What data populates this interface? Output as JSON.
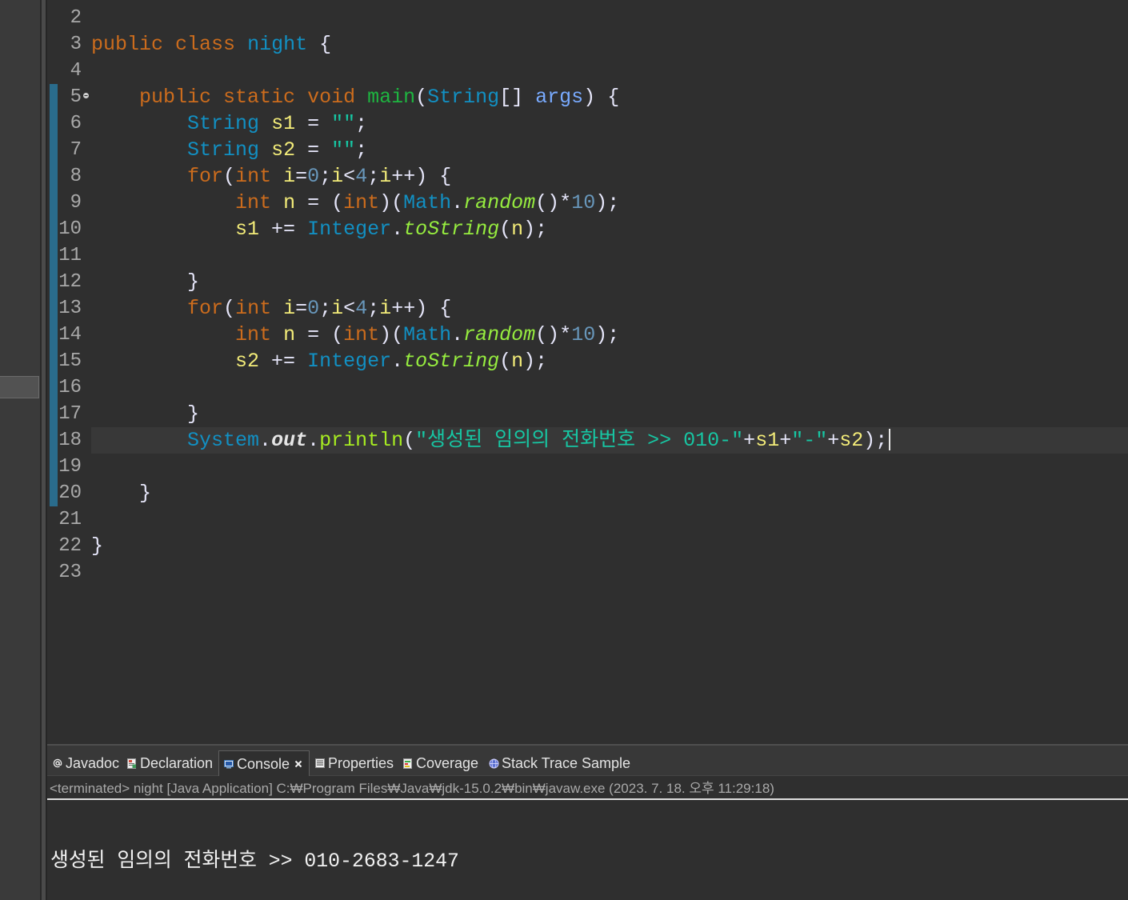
{
  "syntax_colors": {
    "kw": "#cc6c1d",
    "type": "#1290c3",
    "mdecl": "#1eb540",
    "param": "#79abff",
    "var": "#f3ec79",
    "str": "#17c6a3",
    "num": "#6897bb",
    "op": "#e6e6fa",
    "smeth": "#96ec3f",
    "meth": "#a7ec21",
    "sfield": "#e6e6e6"
  },
  "editor": {
    "current_line": 18,
    "caret_line": 18,
    "lines": [
      {
        "num": "2",
        "tokens": []
      },
      {
        "num": "3",
        "tokens": [
          [
            "public",
            "kw"
          ],
          [
            " ",
            "ws"
          ],
          [
            "class",
            "kw"
          ],
          [
            " ",
            "ws"
          ],
          [
            "night",
            "type"
          ],
          [
            " {",
            "op"
          ]
        ]
      },
      {
        "num": "4",
        "tokens": []
      },
      {
        "num": "5",
        "modified": true,
        "fold_icon": "fold-collapse-icon",
        "tokens": [
          [
            "    ",
            "ws"
          ],
          [
            "public",
            "kw"
          ],
          [
            " ",
            "ws"
          ],
          [
            "static",
            "kw"
          ],
          [
            " ",
            "ws"
          ],
          [
            "void",
            "kw"
          ],
          [
            " ",
            "ws"
          ],
          [
            "main",
            "mdecl"
          ],
          [
            "(",
            "op"
          ],
          [
            "String",
            "type"
          ],
          [
            "[] ",
            "op"
          ],
          [
            "args",
            "param"
          ],
          [
            ") {",
            "op"
          ]
        ]
      },
      {
        "num": "6",
        "modified": true,
        "tokens": [
          [
            "        ",
            "ws"
          ],
          [
            "String",
            "type"
          ],
          [
            " ",
            "ws"
          ],
          [
            "s1",
            "var"
          ],
          [
            " = ",
            "op"
          ],
          [
            "\"\"",
            "str"
          ],
          [
            ";",
            "op"
          ]
        ]
      },
      {
        "num": "7",
        "modified": true,
        "tokens": [
          [
            "        ",
            "ws"
          ],
          [
            "String",
            "type"
          ],
          [
            " ",
            "ws"
          ],
          [
            "s2",
            "var"
          ],
          [
            " = ",
            "op"
          ],
          [
            "\"\"",
            "str"
          ],
          [
            ";",
            "op"
          ]
        ]
      },
      {
        "num": "8",
        "modified": true,
        "tokens": [
          [
            "        ",
            "ws"
          ],
          [
            "for",
            "kw"
          ],
          [
            "(",
            "op"
          ],
          [
            "int",
            "kw"
          ],
          [
            " ",
            "ws"
          ],
          [
            "i",
            "var"
          ],
          [
            "=",
            "op"
          ],
          [
            "0",
            "num"
          ],
          [
            ";",
            "op"
          ],
          [
            "i",
            "var"
          ],
          [
            "<",
            "op"
          ],
          [
            "4",
            "num"
          ],
          [
            ";",
            "op"
          ],
          [
            "i",
            "var"
          ],
          [
            "++) {",
            "op"
          ]
        ]
      },
      {
        "num": "9",
        "modified": true,
        "tokens": [
          [
            "            ",
            "ws"
          ],
          [
            "int",
            "kw"
          ],
          [
            " ",
            "ws"
          ],
          [
            "n",
            "var"
          ],
          [
            " = (",
            "op"
          ],
          [
            "int",
            "kw"
          ],
          [
            ")(",
            "op"
          ],
          [
            "Math",
            "type"
          ],
          [
            ".",
            "op"
          ],
          [
            "random",
            "smeth"
          ],
          [
            "()*",
            "op"
          ],
          [
            "10",
            "num"
          ],
          [
            ");",
            "op"
          ]
        ]
      },
      {
        "num": "10",
        "modified": true,
        "tokens": [
          [
            "            ",
            "ws"
          ],
          [
            "s1",
            "var"
          ],
          [
            " += ",
            "op"
          ],
          [
            "Integer",
            "type"
          ],
          [
            ".",
            "op"
          ],
          [
            "toString",
            "smeth"
          ],
          [
            "(",
            "op"
          ],
          [
            "n",
            "var"
          ],
          [
            ");",
            "op"
          ]
        ]
      },
      {
        "num": "11",
        "modified": true,
        "tokens": []
      },
      {
        "num": "12",
        "modified": true,
        "tokens": [
          [
            "        ",
            "ws"
          ],
          [
            "}",
            "op"
          ]
        ]
      },
      {
        "num": "13",
        "modified": true,
        "tokens": [
          [
            "        ",
            "ws"
          ],
          [
            "for",
            "kw"
          ],
          [
            "(",
            "op"
          ],
          [
            "int",
            "kw"
          ],
          [
            " ",
            "ws"
          ],
          [
            "i",
            "var"
          ],
          [
            "=",
            "op"
          ],
          [
            "0",
            "num"
          ],
          [
            ";",
            "op"
          ],
          [
            "i",
            "var"
          ],
          [
            "<",
            "op"
          ],
          [
            "4",
            "num"
          ],
          [
            ";",
            "op"
          ],
          [
            "i",
            "var"
          ],
          [
            "++) {",
            "op"
          ]
        ]
      },
      {
        "num": "14",
        "modified": true,
        "tokens": [
          [
            "            ",
            "ws"
          ],
          [
            "int",
            "kw"
          ],
          [
            " ",
            "ws"
          ],
          [
            "n",
            "var"
          ],
          [
            " = (",
            "op"
          ],
          [
            "int",
            "kw"
          ],
          [
            ")(",
            "op"
          ],
          [
            "Math",
            "type"
          ],
          [
            ".",
            "op"
          ],
          [
            "random",
            "smeth"
          ],
          [
            "()*",
            "op"
          ],
          [
            "10",
            "num"
          ],
          [
            ");",
            "op"
          ]
        ]
      },
      {
        "num": "15",
        "modified": true,
        "tokens": [
          [
            "            ",
            "ws"
          ],
          [
            "s2",
            "var"
          ],
          [
            " += ",
            "op"
          ],
          [
            "Integer",
            "type"
          ],
          [
            ".",
            "op"
          ],
          [
            "toString",
            "smeth"
          ],
          [
            "(",
            "op"
          ],
          [
            "n",
            "var"
          ],
          [
            ");",
            "op"
          ]
        ]
      },
      {
        "num": "16",
        "modified": true,
        "tokens": []
      },
      {
        "num": "17",
        "modified": true,
        "tokens": [
          [
            "        ",
            "ws"
          ],
          [
            "}",
            "op"
          ]
        ]
      },
      {
        "num": "18",
        "modified": true,
        "tokens": [
          [
            "        ",
            "ws"
          ],
          [
            "System",
            "type"
          ],
          [
            ".",
            "op"
          ],
          [
            "out",
            "sfield"
          ],
          [
            ".",
            "op"
          ],
          [
            "println",
            "meth"
          ],
          [
            "(",
            "op"
          ],
          [
            "\"생성된 임의의 전화번호 >> 010-\"",
            "str"
          ],
          [
            "+",
            "op"
          ],
          [
            "s1",
            "var"
          ],
          [
            "+",
            "op"
          ],
          [
            "\"-\"",
            "str"
          ],
          [
            "+",
            "op"
          ],
          [
            "s2",
            "var"
          ],
          [
            ");",
            "op"
          ]
        ]
      },
      {
        "num": "19",
        "modified": true,
        "tokens": []
      },
      {
        "num": "20",
        "modified": true,
        "tokens": [
          [
            "    ",
            "ws"
          ],
          [
            "}",
            "op"
          ]
        ]
      },
      {
        "num": "21",
        "tokens": []
      },
      {
        "num": "22",
        "tokens": [
          [
            "}",
            "op"
          ]
        ]
      },
      {
        "num": "23",
        "tokens": []
      }
    ]
  },
  "bottom_panel": {
    "tabs": [
      {
        "label": "Javadoc",
        "icon": "javadoc-icon"
      },
      {
        "label": "Declaration",
        "icon": "declaration-icon"
      },
      {
        "label": "Console",
        "icon": "console-icon",
        "active": true,
        "close_icon": "close-icon"
      },
      {
        "label": "Properties",
        "icon": "properties-icon"
      },
      {
        "label": "Coverage",
        "icon": "coverage-icon"
      },
      {
        "label": "Stack Trace Sample",
        "icon": "stack-trace-sample-icon"
      }
    ],
    "console": {
      "status": "<terminated> night [Java Application] C:₩Program Files₩Java₩jdk-15.0.2₩bin₩javaw.exe (2023. 7. 18. 오후 11:29:18)",
      "output": [
        "생성된 임의의 전화번호 >> 010-2683-1247"
      ]
    }
  }
}
